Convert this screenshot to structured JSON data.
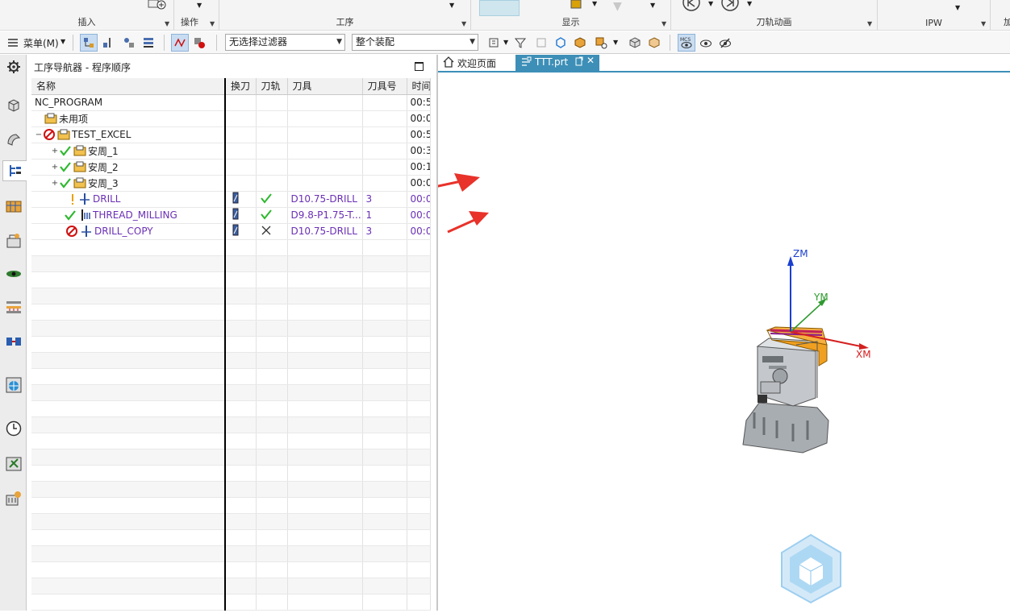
{
  "ribbon": {
    "groups": [
      {
        "label": "插入"
      },
      {
        "label": "操作"
      },
      {
        "label": "工序"
      },
      {
        "label": "显示"
      },
      {
        "label": "刀轨动画"
      },
      {
        "label": "IPW"
      },
      {
        "label": "加"
      }
    ]
  },
  "toolbar": {
    "menu_label": "菜单(M)",
    "filter_select": "无选择过滤器",
    "assembly_select": "整个装配"
  },
  "navigator": {
    "title": "工序导航器 - 程序顺序",
    "columns": [
      "名称",
      "换刀",
      "刀轨",
      "刀具",
      "刀具号",
      "时间"
    ],
    "rows": [
      {
        "name": "NC_PROGRAM",
        "change": "",
        "path": "",
        "tool": "",
        "tool_no": "",
        "time": "00:5"
      },
      {
        "name": "未用项",
        "change": "",
        "path": "",
        "tool": "",
        "tool_no": "",
        "time": "00:0"
      },
      {
        "name": "TEST_EXCEL",
        "change": "",
        "path": "",
        "tool": "",
        "tool_no": "",
        "time": "00:5"
      },
      {
        "name": "安周_1",
        "change": "",
        "path": "",
        "tool": "",
        "tool_no": "",
        "time": "00:3"
      },
      {
        "name": "安周_2",
        "change": "",
        "path": "",
        "tool": "",
        "tool_no": "",
        "time": "00:1"
      },
      {
        "name": "安周_3",
        "change": "",
        "path": "",
        "tool": "",
        "tool_no": "",
        "time": "00:0"
      },
      {
        "name": "DRILL",
        "change": "",
        "path": "",
        "tool": "D10.75-DRILL",
        "tool_no": "3",
        "time": "00:0"
      },
      {
        "name": "THREAD_MILLING",
        "change": "",
        "path": "",
        "tool": "D9.8-P1.75-T...",
        "tool_no": "1",
        "time": "00:0"
      },
      {
        "name": "DRILL_COPY",
        "change": "",
        "path": "",
        "tool": "D10.75-DRILL",
        "tool_no": "3",
        "time": "00:0"
      }
    ]
  },
  "tabs": [
    {
      "label": "欢迎页面"
    },
    {
      "label": "TTT.prt"
    }
  ],
  "viewport": {
    "axes": {
      "z": "ZM",
      "y": "YM",
      "x": "XM"
    }
  },
  "colors": {
    "accent": "#3d8fb7",
    "op_text": "#6a2fb5",
    "check": "#2eb82e",
    "stop": "#d01010",
    "arrow": "#e8322a",
    "axis_z": "#1a3fcf",
    "axis_y": "#2f9a2f",
    "axis_x": "#d42020"
  }
}
